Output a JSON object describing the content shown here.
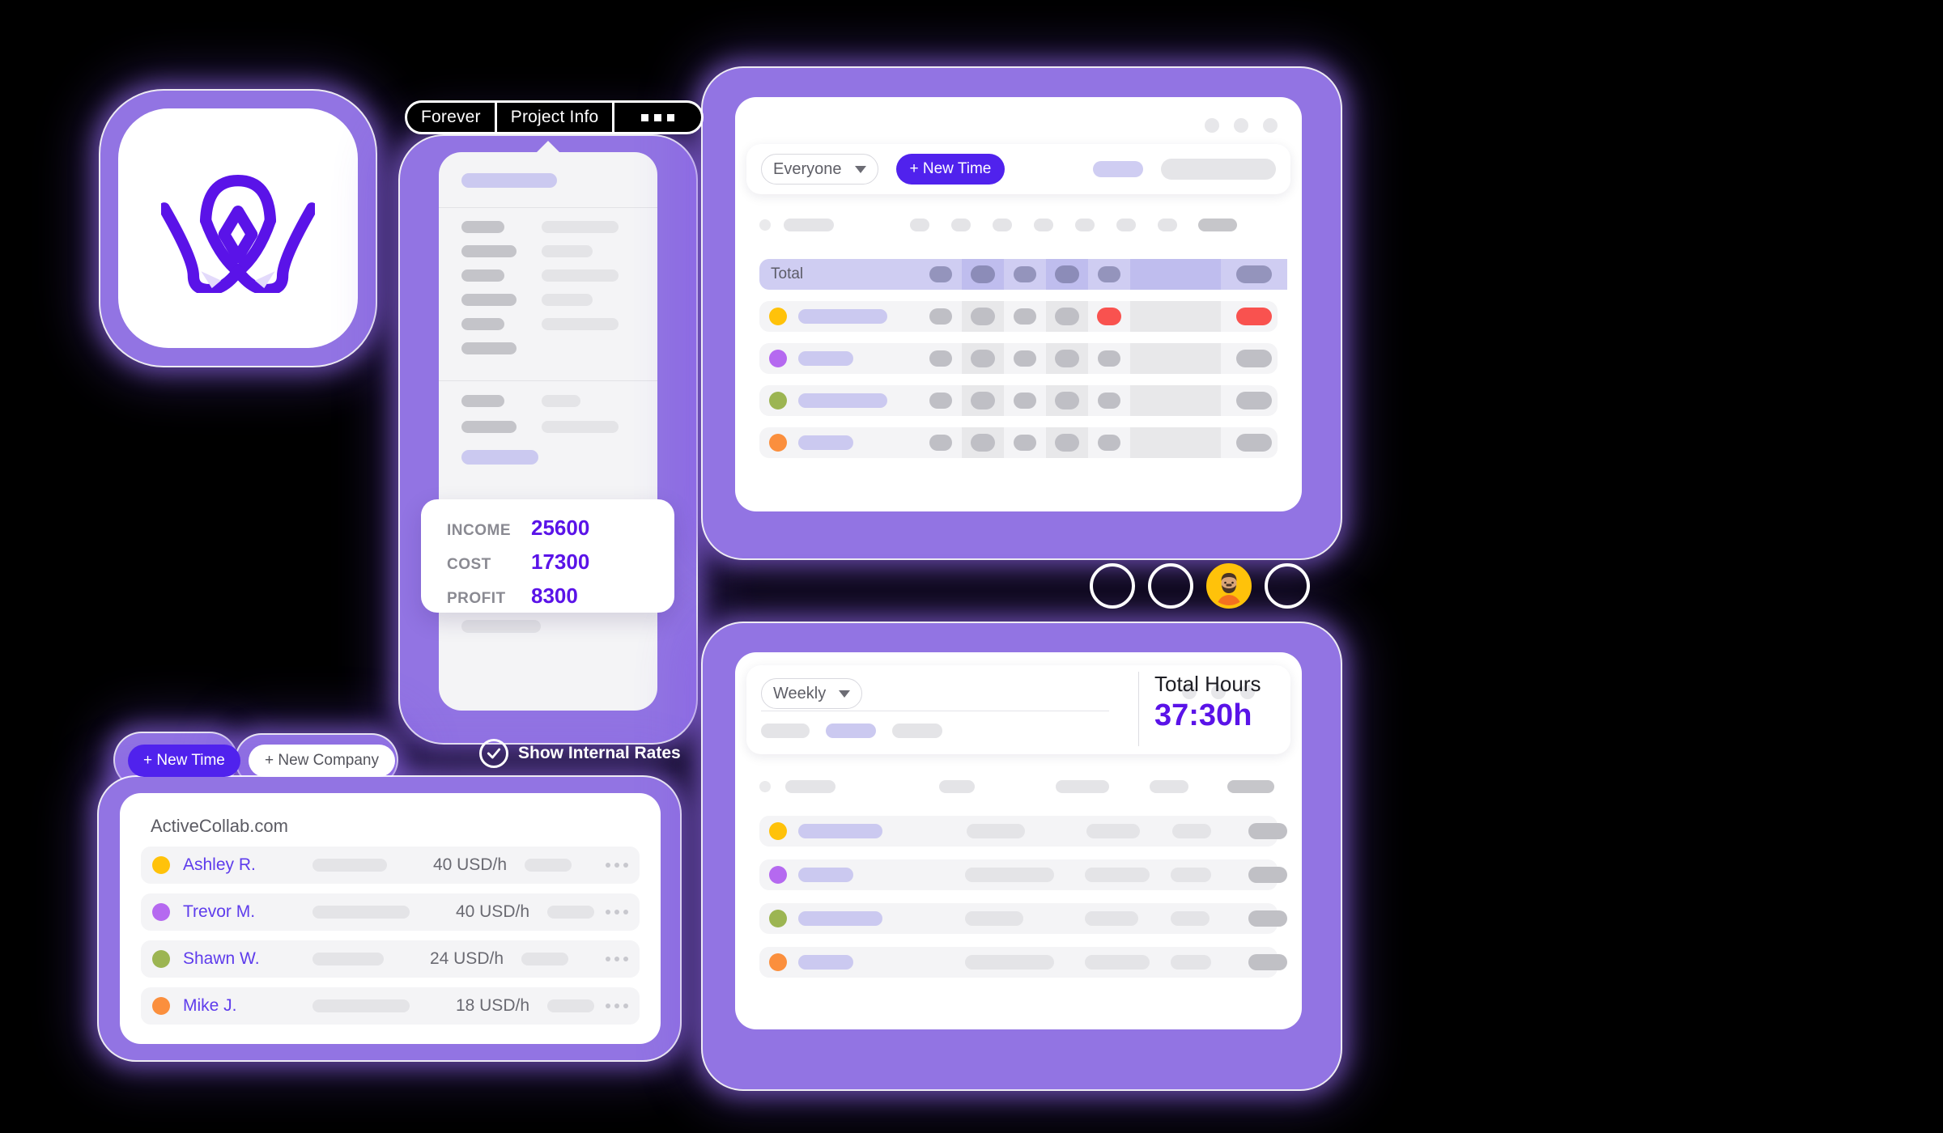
{
  "brand": {
    "accent": "#5022ED",
    "accent_deep": "#5A13E8",
    "frame": "#9274E3",
    "logo_name": "activecollab-logo"
  },
  "tooltip_bar": {
    "segments": [
      "Forever",
      "Project Info"
    ],
    "more_icon": "ellipsis-icon"
  },
  "income_card": {
    "rows": [
      {
        "label": "INCOME",
        "value": "25600"
      },
      {
        "label": "COST",
        "value": "17300"
      },
      {
        "label": "PROFIT",
        "value": "8300"
      }
    ]
  },
  "internal_rates": {
    "label": "Show Internal Rates",
    "checked": true,
    "icon": "check-circle-icon"
  },
  "quick_actions": {
    "new_time": "+ New Time",
    "new_company": "+ New Company"
  },
  "people_panel": {
    "title": "ActiveCollab.com",
    "rows": [
      {
        "name": "Ashley R.",
        "rate": "40 USD/h",
        "color": "#FFC20A"
      },
      {
        "name": "Trevor M.",
        "rate": "40 USD/h",
        "color": "#B569F0"
      },
      {
        "name": "Shawn W.",
        "rate": "24 USD/h",
        "color": "#9CB552"
      },
      {
        "name": "Mike J.",
        "rate": "18 USD/h",
        "color": "#FB8F3D"
      }
    ],
    "row_menu_icon": "ellipsis-icon"
  },
  "time_window": {
    "filter_label": "Everyone",
    "new_time_label": "+ New Time",
    "total_row_label": "Total",
    "window_dots_icon": "window-controls-icon",
    "caret_icon": "chevron-down-icon",
    "row_colors": [
      "#FFC20A",
      "#B569F0",
      "#9CB552",
      "#FB8F3D"
    ],
    "alert_color": "#F9524F"
  },
  "weekly_window": {
    "filter_label": "Weekly",
    "total_hours_label": "Total Hours",
    "total_hours_value": "37:30h",
    "window_dots_icon": "window-controls-icon",
    "caret_icon": "chevron-down-icon",
    "row_colors": [
      "#FFC20A",
      "#B569F0",
      "#9CB552",
      "#FB8F3D"
    ]
  },
  "avatar_cluster": {
    "count": 4,
    "active_index": 2,
    "active_icon": "user-avatar-bearded"
  }
}
